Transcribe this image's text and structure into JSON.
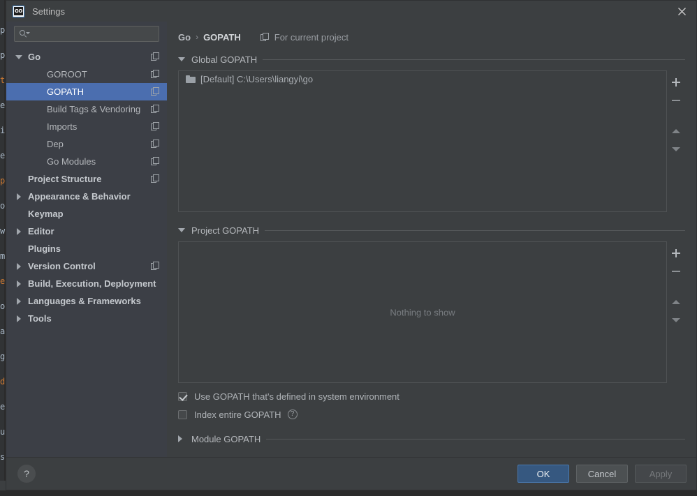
{
  "window": {
    "title": "Settings",
    "app_icon": "go-logo-icon",
    "close_icon": "close-icon"
  },
  "background_editor": {
    "fragments": [
      "p",
      "p",
      "t",
      "e",
      "i",
      "e",
      "p",
      "o",
      "w",
      "m",
      "e",
      "o",
      "a",
      "g",
      "d",
      "e",
      "u",
      "s"
    ]
  },
  "search": {
    "value": "",
    "placeholder": ""
  },
  "sidebar": {
    "items": [
      {
        "label": "Go",
        "level": 0,
        "arrow": "down",
        "bold": true,
        "scope_icon": true,
        "selected": false
      },
      {
        "label": "GOROOT",
        "level": 1,
        "arrow": "none",
        "bold": false,
        "scope_icon": true,
        "selected": false
      },
      {
        "label": "GOPATH",
        "level": 1,
        "arrow": "none",
        "bold": false,
        "scope_icon": true,
        "selected": true
      },
      {
        "label": "Build Tags & Vendoring",
        "level": 1,
        "arrow": "none",
        "bold": false,
        "scope_icon": true,
        "selected": false
      },
      {
        "label": "Imports",
        "level": 1,
        "arrow": "none",
        "bold": false,
        "scope_icon": true,
        "selected": false
      },
      {
        "label": "Dep",
        "level": 1,
        "arrow": "none",
        "bold": false,
        "scope_icon": true,
        "selected": false
      },
      {
        "label": "Go Modules",
        "level": 1,
        "arrow": "none",
        "bold": false,
        "scope_icon": true,
        "selected": false
      },
      {
        "label": "Project Structure",
        "level": 0,
        "arrow": "none",
        "bold": true,
        "scope_icon": true,
        "selected": false
      },
      {
        "label": "Appearance & Behavior",
        "level": 0,
        "arrow": "right",
        "bold": true,
        "scope_icon": false,
        "selected": false
      },
      {
        "label": "Keymap",
        "level": 0,
        "arrow": "none",
        "bold": true,
        "scope_icon": false,
        "selected": false
      },
      {
        "label": "Editor",
        "level": 0,
        "arrow": "right",
        "bold": true,
        "scope_icon": false,
        "selected": false
      },
      {
        "label": "Plugins",
        "level": 0,
        "arrow": "none",
        "bold": true,
        "scope_icon": false,
        "selected": false
      },
      {
        "label": "Version Control",
        "level": 0,
        "arrow": "right",
        "bold": true,
        "scope_icon": true,
        "selected": false
      },
      {
        "label": "Build, Execution, Deployment",
        "level": 0,
        "arrow": "right",
        "bold": true,
        "scope_icon": false,
        "selected": false
      },
      {
        "label": "Languages & Frameworks",
        "level": 0,
        "arrow": "right",
        "bold": true,
        "scope_icon": false,
        "selected": false
      },
      {
        "label": "Tools",
        "level": 0,
        "arrow": "right",
        "bold": true,
        "scope_icon": false,
        "selected": false
      }
    ]
  },
  "content": {
    "breadcrumb": {
      "root": "Go",
      "separator": "›",
      "current": "GOPATH"
    },
    "for_current_project": "For current project",
    "global_section": {
      "title": "Global GOPATH",
      "expanded": true,
      "entries": [
        "[Default] C:\\Users\\liangyi\\go"
      ]
    },
    "project_section": {
      "title": "Project GOPATH",
      "expanded": true,
      "empty_text": "Nothing to show",
      "entries": []
    },
    "module_section": {
      "title": "Module GOPATH",
      "expanded": false
    },
    "toolbar": {
      "add": "add-icon",
      "remove": "remove-icon",
      "move_up": "move-up-icon",
      "move_down": "move-down-icon"
    },
    "checkboxes": [
      {
        "label": "Use GOPATH that's defined in system environment",
        "checked": true,
        "help": false
      },
      {
        "label": "Index entire GOPATH",
        "checked": false,
        "help": true
      }
    ],
    "help_glyph": "?"
  },
  "footer": {
    "help": "?",
    "ok": "OK",
    "cancel": "Cancel",
    "apply": "Apply"
  },
  "colors": {
    "accent": "#4b6eaf",
    "primary_button": "#365880",
    "dialog_bg": "#3c3f41",
    "sidebar_bg": "#3c3f46"
  }
}
